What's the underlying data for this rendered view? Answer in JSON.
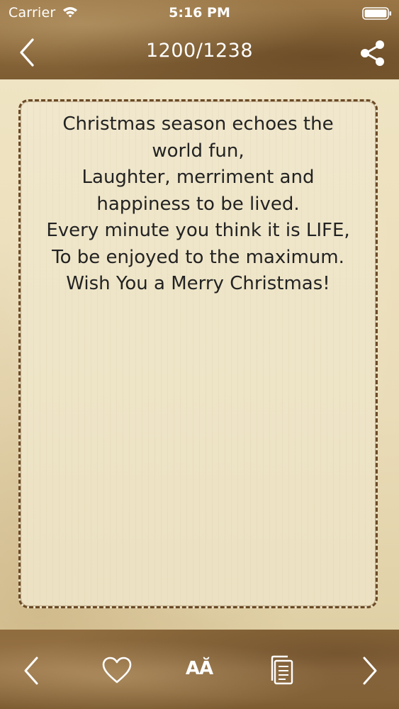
{
  "status_bar": {
    "carrier": "Carrier",
    "time": "5:16 PM",
    "icons": [
      "wifi-icon",
      "battery-icon"
    ]
  },
  "nav": {
    "title": "1200/1238",
    "icons": [
      "chevron-left-icon",
      "share-icon"
    ]
  },
  "message": {
    "lines": [
      "Christmas season echoes the",
      "world fun,",
      "Laughter, merriment and",
      "happiness to be lived.",
      "Every minute you think it is LIFE,",
      "To be enjoyed to the maximum.",
      "Wish You a Merry Christmas!"
    ]
  },
  "toolbar": {
    "font_label": "AĂ",
    "icons": [
      "chevron-left-icon",
      "heart-icon",
      "font-size-icon",
      "copy-icon",
      "chevron-right-icon"
    ]
  },
  "colors": {
    "leather": "#8d6a3c",
    "paper": "#efe4c3",
    "card_border": "#6b4a26",
    "text": "#222222",
    "icon": "#ffffff"
  }
}
